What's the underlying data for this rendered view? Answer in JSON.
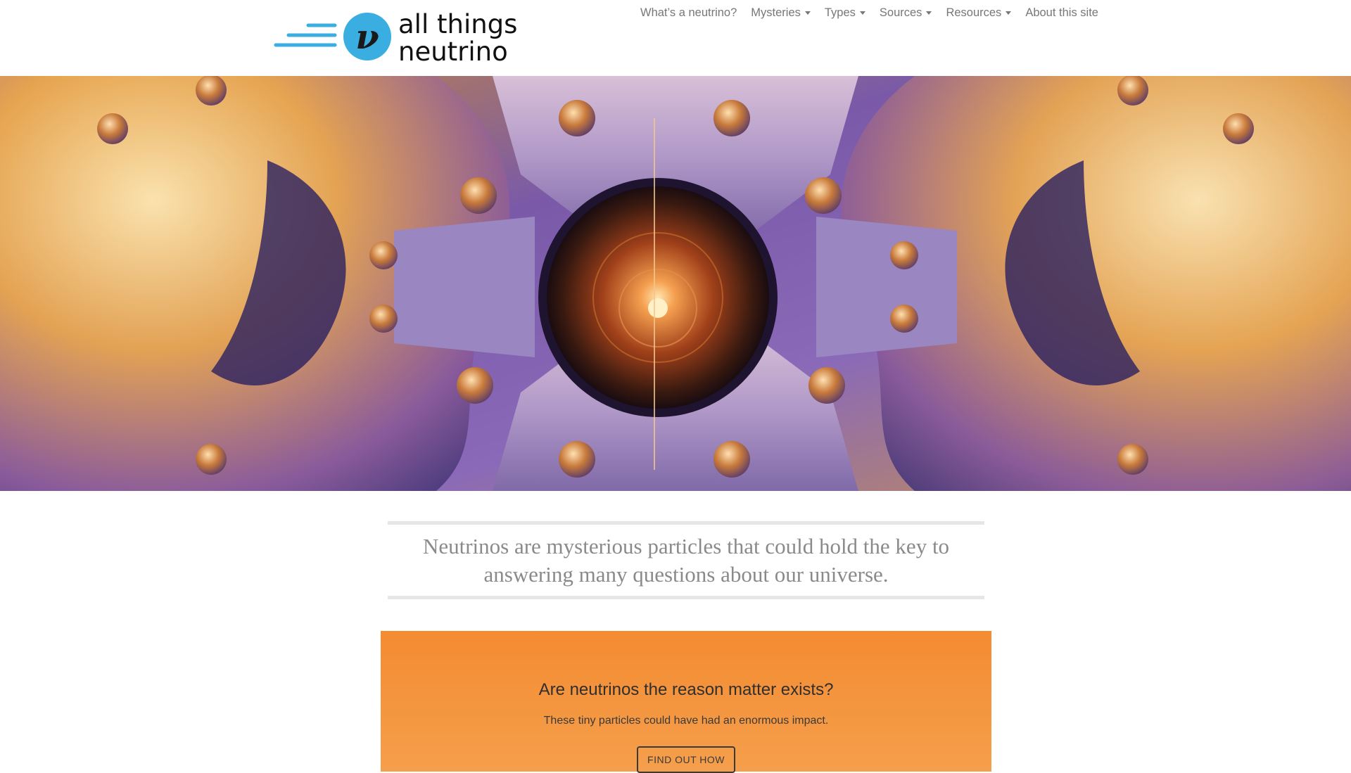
{
  "brand": {
    "line1": "all things",
    "line2": "neutrino",
    "symbol": "ν",
    "accent_color": "#3aaee0"
  },
  "nav": {
    "items": [
      {
        "label": "What’s a neutrino?",
        "dropdown": false
      },
      {
        "label": "Mysteries",
        "dropdown": true
      },
      {
        "label": "Types",
        "dropdown": true
      },
      {
        "label": "Sources",
        "dropdown": true
      },
      {
        "label": "Resources",
        "dropdown": true
      },
      {
        "label": "About this site",
        "dropdown": false
      }
    ]
  },
  "hero": {
    "image": "particle-detector-photo"
  },
  "tagline": {
    "text": "Neutrinos are mysterious particles that could hold the key to answering many questions about our universe."
  },
  "callout": {
    "title": "Are neutrinos the reason matter exists?",
    "text": "These tiny particles could have had an enormous impact.",
    "button_label": "FIND OUT HOW",
    "color": "#f48b31"
  }
}
